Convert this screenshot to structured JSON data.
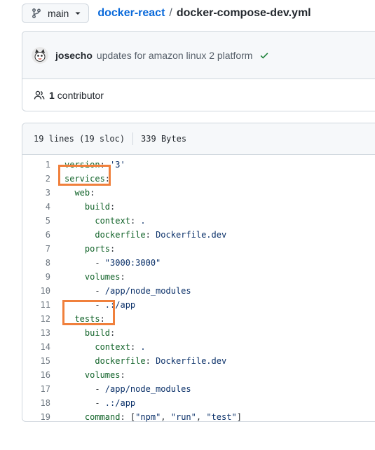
{
  "breadcrumb": {
    "branch": "main",
    "repo": "docker-react",
    "separator": "/",
    "file": "docker-compose-dev.yml"
  },
  "commit": {
    "author": "josecho",
    "message": "updates for amazon linux 2 platform",
    "status_icon": "check-icon"
  },
  "contributors": {
    "count": "1",
    "label": "contributor"
  },
  "file_info": {
    "lines": "19 lines (19 sloc)",
    "size": "339 Bytes"
  },
  "code_lines": [
    {
      "num": "1",
      "tokens": [
        {
          "t": "version",
          "c": "k"
        },
        {
          "t": ": "
        },
        {
          "t": "'3'",
          "c": "s"
        }
      ]
    },
    {
      "num": "2",
      "tokens": [
        {
          "t": "services",
          "c": "k"
        },
        {
          "t": ":"
        }
      ]
    },
    {
      "num": "3",
      "tokens": [
        {
          "t": "  "
        },
        {
          "t": "web",
          "c": "k"
        },
        {
          "t": ":"
        }
      ]
    },
    {
      "num": "4",
      "tokens": [
        {
          "t": "    "
        },
        {
          "t": "build",
          "c": "k"
        },
        {
          "t": ":"
        }
      ]
    },
    {
      "num": "5",
      "tokens": [
        {
          "t": "      "
        },
        {
          "t": "context",
          "c": "k"
        },
        {
          "t": ": "
        },
        {
          "t": ".",
          "c": "s"
        }
      ]
    },
    {
      "num": "6",
      "tokens": [
        {
          "t": "      "
        },
        {
          "t": "dockerfile",
          "c": "k"
        },
        {
          "t": ": "
        },
        {
          "t": "Dockerfile.dev",
          "c": "s"
        }
      ]
    },
    {
      "num": "7",
      "tokens": [
        {
          "t": "    "
        },
        {
          "t": "ports",
          "c": "k"
        },
        {
          "t": ":"
        }
      ]
    },
    {
      "num": "8",
      "tokens": [
        {
          "t": "      - "
        },
        {
          "t": "\"3000:3000\"",
          "c": "s"
        }
      ]
    },
    {
      "num": "9",
      "tokens": [
        {
          "t": "    "
        },
        {
          "t": "volumes",
          "c": "k"
        },
        {
          "t": ":"
        }
      ]
    },
    {
      "num": "10",
      "tokens": [
        {
          "t": "      - "
        },
        {
          "t": "/app/node_modules",
          "c": "s"
        }
      ]
    },
    {
      "num": "11",
      "tokens": [
        {
          "t": "      - "
        },
        {
          "t": ".:/app",
          "c": "s"
        }
      ]
    },
    {
      "num": "12",
      "tokens": [
        {
          "t": "  "
        },
        {
          "t": "tests",
          "c": "k"
        },
        {
          "t": ":"
        }
      ]
    },
    {
      "num": "13",
      "tokens": [
        {
          "t": "    "
        },
        {
          "t": "build",
          "c": "k"
        },
        {
          "t": ":"
        }
      ]
    },
    {
      "num": "14",
      "tokens": [
        {
          "t": "      "
        },
        {
          "t": "context",
          "c": "k"
        },
        {
          "t": ": "
        },
        {
          "t": ".",
          "c": "s"
        }
      ]
    },
    {
      "num": "15",
      "tokens": [
        {
          "t": "      "
        },
        {
          "t": "dockerfile",
          "c": "k"
        },
        {
          "t": ": "
        },
        {
          "t": "Dockerfile.dev",
          "c": "s"
        }
      ]
    },
    {
      "num": "16",
      "tokens": [
        {
          "t": "    "
        },
        {
          "t": "volumes",
          "c": "k"
        },
        {
          "t": ":"
        }
      ]
    },
    {
      "num": "17",
      "tokens": [
        {
          "t": "      - "
        },
        {
          "t": "/app/node_modules",
          "c": "s"
        }
      ]
    },
    {
      "num": "18",
      "tokens": [
        {
          "t": "      - "
        },
        {
          "t": ".:/app",
          "c": "s"
        }
      ]
    },
    {
      "num": "19",
      "tokens": [
        {
          "t": "    "
        },
        {
          "t": "command",
          "c": "k"
        },
        {
          "t": ": ["
        },
        {
          "t": "\"npm\"",
          "c": "s"
        },
        {
          "t": ", "
        },
        {
          "t": "\"run\"",
          "c": "s"
        },
        {
          "t": ", "
        },
        {
          "t": "\"test\"",
          "c": "s"
        },
        {
          "t": "]"
        }
      ]
    }
  ],
  "colors": {
    "link": "#0969da",
    "yaml_key": "#116329",
    "yaml_string": "#0a3069",
    "success": "#1a7f37",
    "highlight_box": "#f0803c"
  }
}
